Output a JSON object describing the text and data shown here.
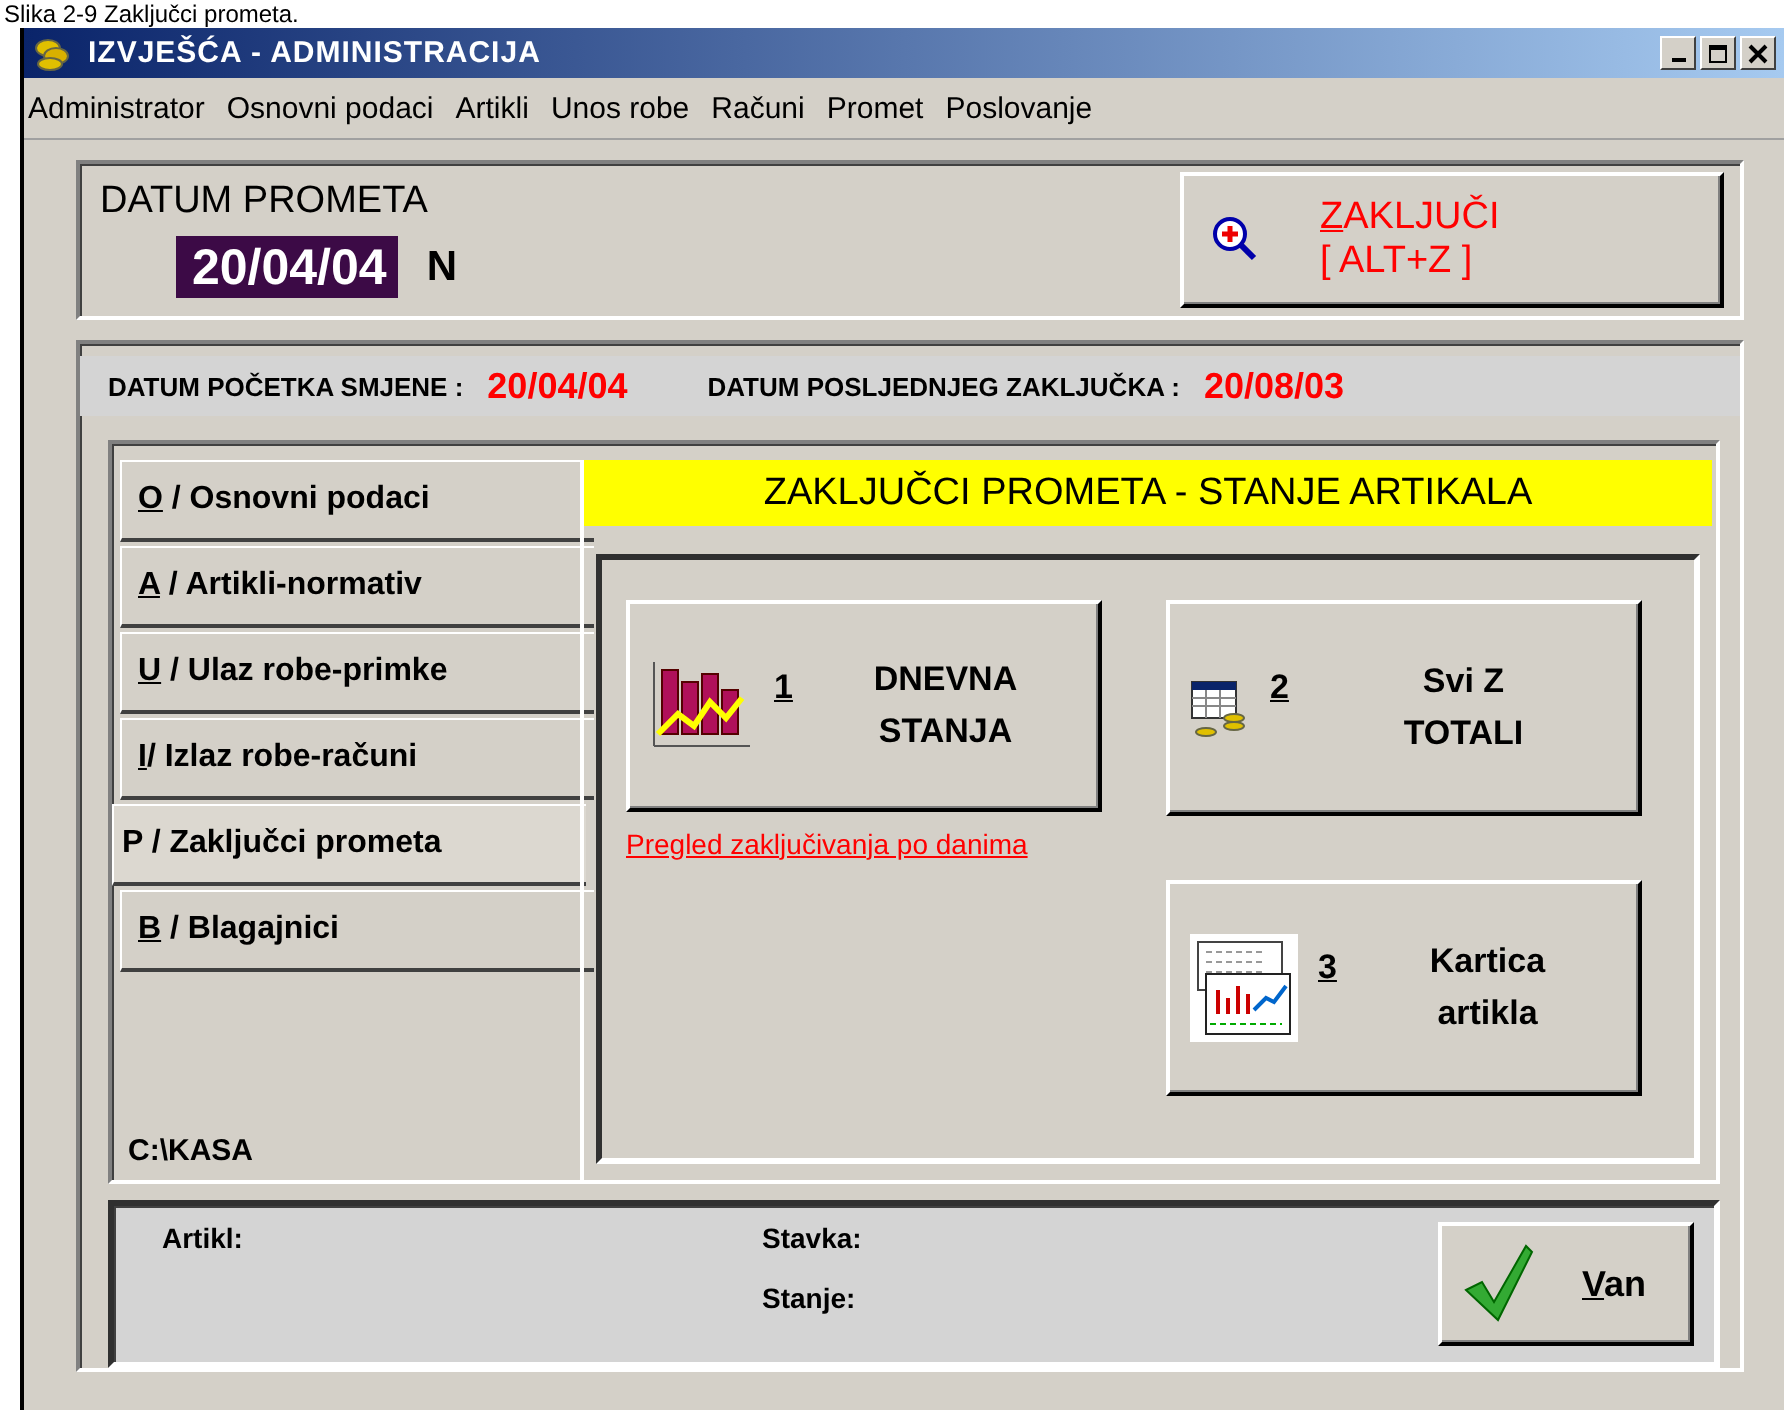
{
  "caption": "Slika 2-9 Zaključci prometa.",
  "window": {
    "title": "IZVJEŠĆA - ADMINISTRACIJA"
  },
  "menu": [
    "Administrator",
    "Osnovni podaci",
    "Artikli",
    "Unos robe",
    "Računi",
    "Promet",
    "Poslovanje"
  ],
  "datum_prometa": {
    "label": "DATUM PROMETA",
    "value": "20/04/04",
    "flag": "N"
  },
  "close_button": {
    "line_1": "ZAKLJUČI",
    "line_2": "[ ALT+Z ]"
  },
  "info": [
    {
      "label": "DATUM POČETKA SMJENE :",
      "value": "20/04/04"
    },
    {
      "label": "DATUM POSLJEDNJEG ZAKLJUČKA :",
      "value": "20/08/03"
    }
  ],
  "tabs": [
    {
      "label": "O / Osnovni podaci",
      "selected": false
    },
    {
      "label": "A / Artikli-normativ",
      "selected": false
    },
    {
      "label": "U / Ulaz robe-primke",
      "selected": false
    },
    {
      "label": "I/ Izlaz robe-računi",
      "selected": false
    },
    {
      "label": "P / Zaključci prometa",
      "selected": true
    },
    {
      "label": "B / Blagajnici",
      "selected": false
    }
  ],
  "path": "C:\\KASA",
  "panel_title": "ZAKLJUČCI PROMETA - STANJE ARTIKALA",
  "actions": [
    {
      "kind": "chart",
      "number": "1",
      "lines": [
        "DNEVNA",
        "STANJA"
      ],
      "link": "Pregled zaključivanja po danima"
    },
    {
      "kind": "table",
      "number": "2",
      "lines": [
        "Svi Z",
        "TOTALI"
      ]
    },
    {
      "kind": "card",
      "number": "3",
      "lines": [
        "Kartica",
        "artikla"
      ]
    }
  ],
  "status": {
    "artikl": "Artikl:",
    "stavka": "Stavka:",
    "stanje": "Stanje:"
  },
  "exit_button": "Van"
}
